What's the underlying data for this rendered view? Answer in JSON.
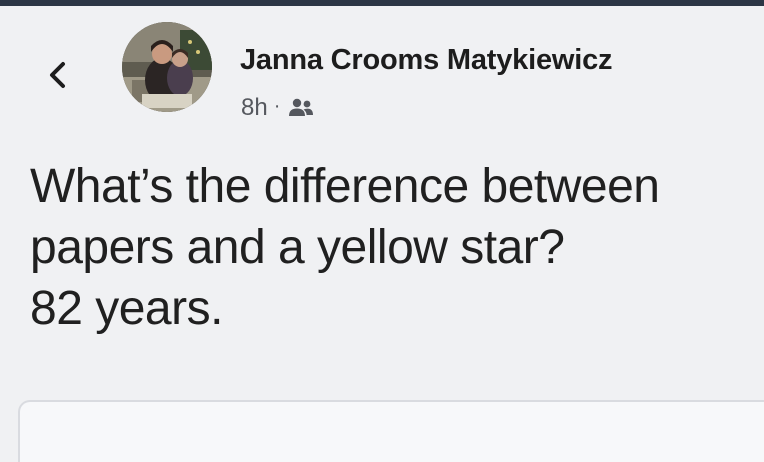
{
  "header": {
    "author_name": "Janna Crooms Matykiewicz",
    "timestamp": "8h",
    "separator": "·",
    "audience_icon": "friends-icon",
    "back_icon": "chevron-left-icon"
  },
  "post": {
    "lines": [
      "What’s the difference between",
      "papers and a yellow star?",
      "82 years."
    ]
  },
  "colors": {
    "background": "#f0f1f3",
    "top_border": "#2c3645",
    "text": "#202020",
    "meta_text": "#55585e"
  }
}
